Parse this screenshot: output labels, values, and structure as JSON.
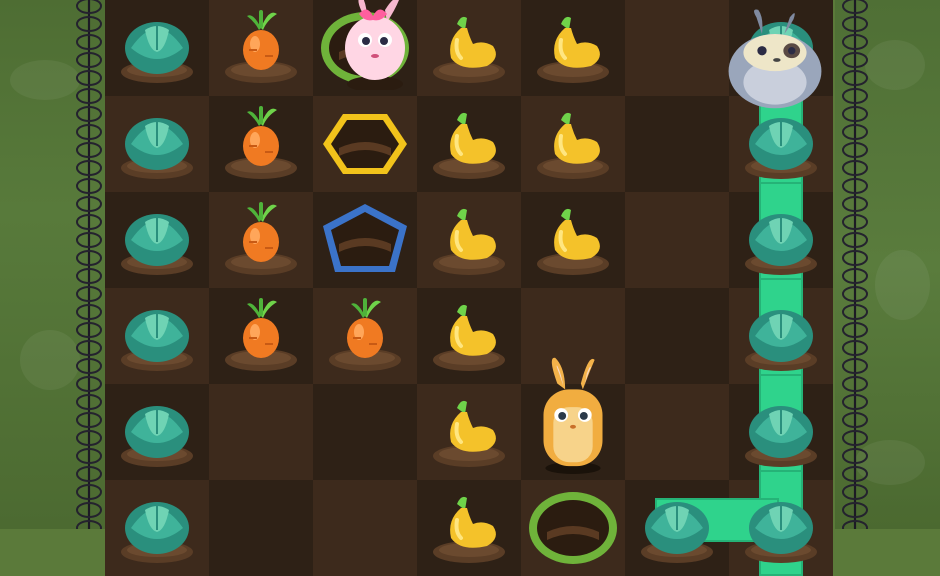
{
  "colors": {
    "soil_dark": "#2e2116",
    "soil_light": "#3d2a1c",
    "grass": "#5b7a3a",
    "path": "#2fd38c",
    "hole_yellow": "#f2c31b",
    "hole_blue": "#3b73c9",
    "hole_green": "#6fb33a"
  },
  "grid": {
    "cols": 7,
    "rows": 6,
    "cells": [
      [
        "cabbage",
        "carrot",
        "hole-green",
        "squash",
        "squash",
        "empty",
        "cabbage"
      ],
      [
        "cabbage",
        "carrot",
        "hole-yellow",
        "squash",
        "squash",
        "empty",
        "cabbage"
      ],
      [
        "cabbage",
        "carrot",
        "hole-blue",
        "squash",
        "squash",
        "empty",
        "cabbage"
      ],
      [
        "cabbage",
        "carrot",
        "carrot",
        "squash",
        "empty",
        "empty",
        "cabbage"
      ],
      [
        "cabbage",
        "empty",
        "empty",
        "squash",
        "empty",
        "empty",
        "cabbage"
      ],
      [
        "cabbage",
        "empty",
        "empty",
        "squash",
        "hole-green",
        "cabbage",
        "cabbage"
      ]
    ]
  },
  "characters": [
    {
      "name": "pink-bunny",
      "col": 2,
      "row": 0,
      "in_hole": true
    },
    {
      "name": "gray-bunny",
      "col": 6,
      "row": 0,
      "in_hole": false
    },
    {
      "name": "orange-bunny",
      "col": 4,
      "row": 4,
      "in_hole": false
    }
  ],
  "path_trail": {
    "cells": [
      [
        6,
        1
      ],
      [
        6,
        2
      ],
      [
        6,
        3
      ],
      [
        6,
        4
      ],
      [
        6,
        5
      ],
      [
        5,
        5
      ]
    ]
  },
  "icons": [
    "cabbage-icon",
    "carrot-icon",
    "squash-icon",
    "hole-icon",
    "bunny-icon",
    "fence-icon"
  ]
}
